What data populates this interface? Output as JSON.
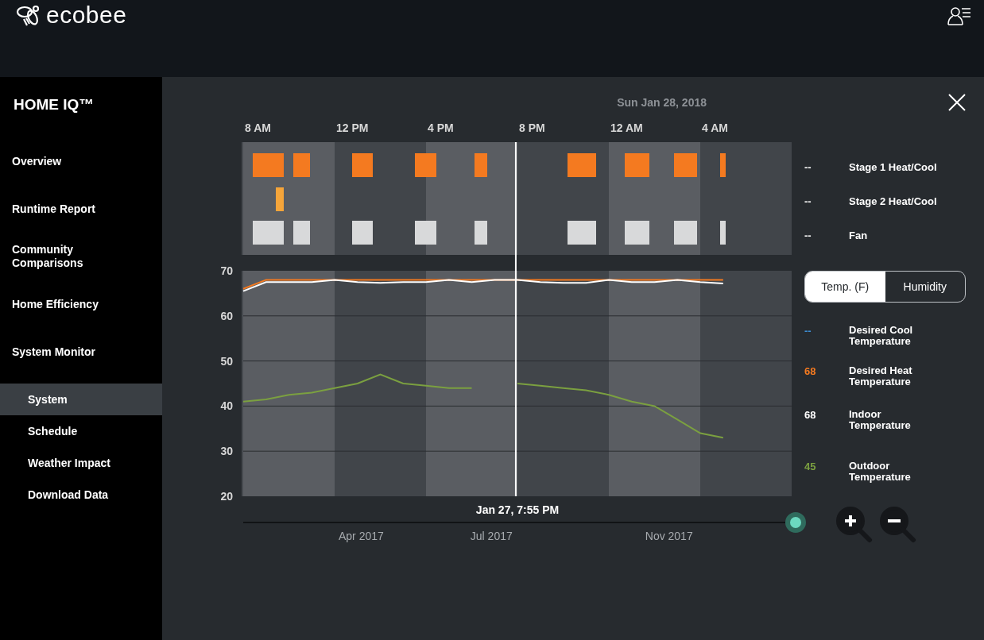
{
  "header": {
    "logo_text": "ecobee"
  },
  "sidebar": {
    "title": "HOME IQ™",
    "items": [
      {
        "label": "Overview",
        "selected": false
      },
      {
        "label": "Runtime Report",
        "selected": false
      },
      {
        "label": "Community Comparisons",
        "selected": false
      },
      {
        "label": "Home Efficiency",
        "selected": false
      },
      {
        "label": "System Monitor",
        "selected": false,
        "children": [
          {
            "label": "System",
            "selected": true
          },
          {
            "label": "Schedule",
            "selected": false
          },
          {
            "label": "Weather Impact",
            "selected": false
          },
          {
            "label": "Download Data",
            "selected": false
          }
        ]
      }
    ]
  },
  "date_label": "Sun Jan 28, 2018",
  "runtime_legend": [
    {
      "value": "--",
      "label": "Stage 1 Heat/Cool"
    },
    {
      "value": "--",
      "label": "Stage 2 Heat/Cool"
    },
    {
      "value": "--",
      "label": "Fan"
    }
  ],
  "toggle": [
    {
      "label": "Temp. (F)",
      "selected": true
    },
    {
      "label": "Humidity",
      "selected": false
    }
  ],
  "temp_legend": [
    {
      "value": "--"
    },
    {
      "value": "68"
    },
    {
      "value": "68"
    },
    {
      "value": "45"
    }
  ],
  "time_axis": [
    "8 AM",
    "12 PM",
    "4 PM",
    "8 PM",
    "12 AM",
    "4 AM"
  ],
  "chart_data": {
    "type": "line",
    "categories": [
      null,
      null,
      null,
      null,
      null,
      null,
      null,
      null,
      null,
      null,
      null,
      null,
      null,
      null,
      null,
      null,
      null,
      null,
      null,
      null,
      null,
      null
    ],
    "ylim": [
      20,
      70
    ],
    "grid": true,
    "yticks": [
      {
        "value": 20,
        "label": "20"
      },
      {
        "value": 30,
        "label": "30"
      },
      {
        "value": 40,
        "label": "40"
      },
      {
        "value": 50,
        "label": "50"
      },
      {
        "value": 60,
        "label": "60"
      },
      {
        "value": 70,
        "label": "70"
      }
    ],
    "series": [
      {
        "name": "Desired Cool Temperature",
        "color": "#3d8fd6",
        "values": [
          null,
          null,
          null,
          null,
          null,
          null,
          null,
          null,
          null,
          null,
          null,
          null,
          null,
          null,
          null,
          null,
          null,
          null,
          null,
          null,
          null,
          null
        ]
      },
      {
        "name": "Desired Heat Temperature",
        "color": "#f47a20",
        "values": [
          66,
          68,
          68,
          68,
          68,
          68,
          68,
          68,
          68,
          68,
          68,
          68,
          68,
          68,
          68,
          68,
          68,
          68,
          68,
          68,
          68,
          68
        ]
      },
      {
        "name": "Indoor Temperature",
        "color": "#ffffff",
        "values": [
          65.5,
          67.5,
          67.5,
          67.5,
          68,
          67.5,
          67.3,
          67.5,
          67.5,
          68,
          67.5,
          68,
          68,
          67.5,
          67.3,
          67.3,
          68,
          67.5,
          67.5,
          68,
          67.5,
          67.2
        ]
      },
      {
        "name": "Outdoor Temperature",
        "color": "#7ba040",
        "values": [
          41,
          41.5,
          42.5,
          43,
          44,
          45,
          47,
          45,
          44.5,
          44,
          44,
          null,
          45,
          44.5,
          44,
          43.5,
          42.5,
          41,
          40,
          37,
          34,
          33
        ]
      }
    ]
  },
  "cursor": {
    "label": "Jan 27, 7:55 PM",
    "level": 0.497
  },
  "timeline": {
    "level": 1,
    "labels": [
      "Apr 2017",
      "Jul 2017",
      "Nov 2017"
    ]
  }
}
